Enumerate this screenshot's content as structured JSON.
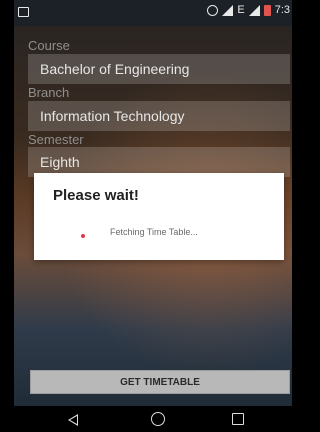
{
  "status_bar": {
    "time": "7:3",
    "signal_label": "E",
    "left_icon": "image-notification-icon",
    "alarm_icon": "alarm-icon",
    "signal_icon": "signal-icon",
    "battery_icon": "battery-low-icon",
    "battery_color": "#e1534f"
  },
  "form": {
    "course_label": "Course",
    "course_value": "Bachelor of Engineering",
    "branch_label": "Branch",
    "branch_value": "Information Technology",
    "semester_label": "Semester",
    "semester_value": "Eighth",
    "get_button": "GET TIMETABLE"
  },
  "dialog": {
    "title": "Please wait!",
    "message": "Fetching Time Table...",
    "spinner_color": "#e03b48"
  },
  "nav": {
    "back_icon": "back-icon",
    "home_icon": "home-icon",
    "recents_icon": "recents-icon"
  }
}
